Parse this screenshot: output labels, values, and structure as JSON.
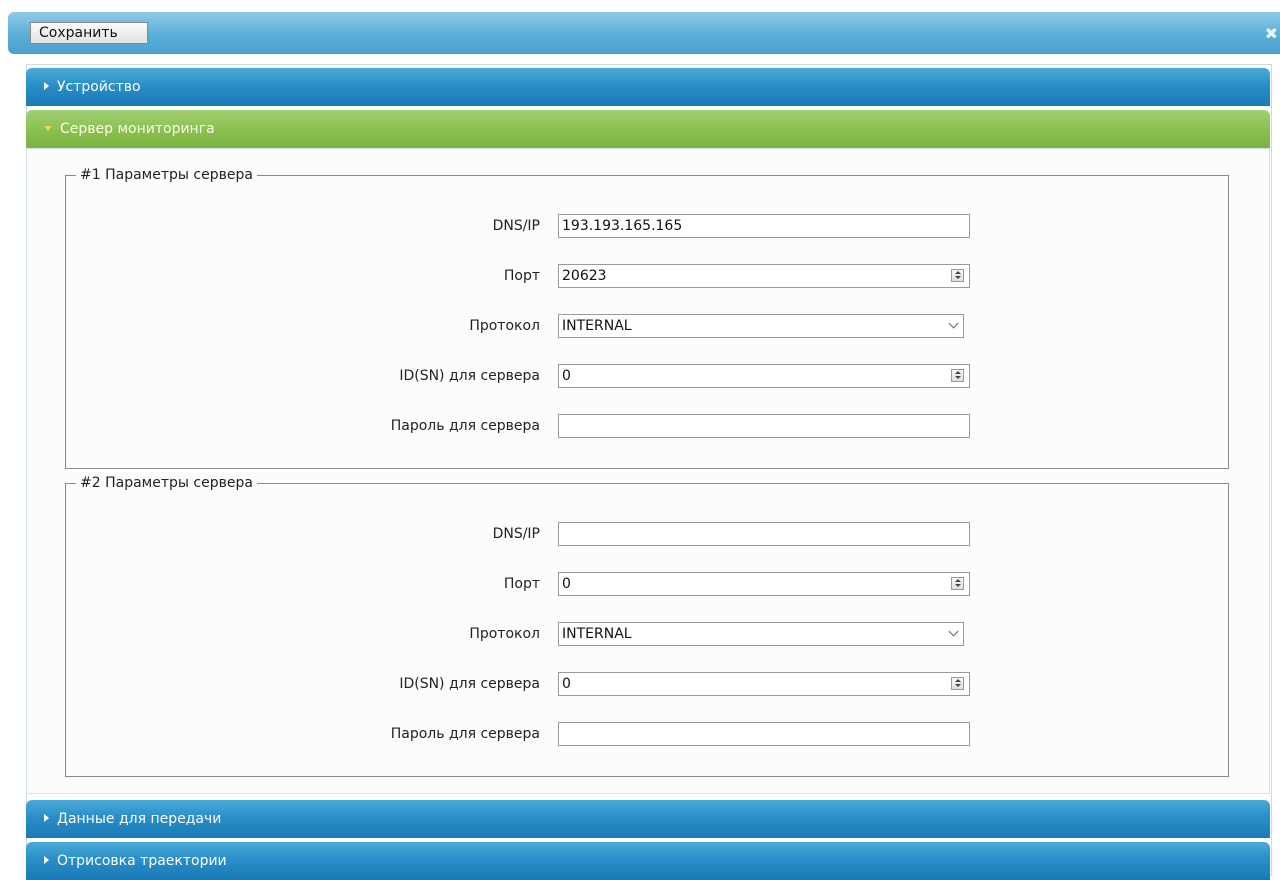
{
  "toolbar": {
    "save_label": "Сохранить",
    "close_glyph": "✖"
  },
  "accordion": [
    {
      "label": "Устройство",
      "expanded": false
    },
    {
      "label": "Сервер мониторинга",
      "expanded": true
    },
    {
      "label": "Данные для передачи",
      "expanded": false
    },
    {
      "label": "Отрисовка траектории",
      "expanded": false
    }
  ],
  "servers": [
    {
      "legend": "#1 Параметры сервера",
      "dns_label": "DNS/IP",
      "dns_value": "193.193.165.165",
      "port_label": "Порт",
      "port_value": "20623",
      "protocol_label": "Протокол",
      "protocol_value": "INTERNAL",
      "id_label": "ID(SN) для сервера",
      "id_value": "0",
      "password_label": "Пароль для сервера",
      "password_value": ""
    },
    {
      "legend": "#2 Параметры сервера",
      "dns_label": "DNS/IP",
      "dns_value": "",
      "port_label": "Порт",
      "port_value": "0",
      "protocol_label": "Протокол",
      "protocol_value": "INTERNAL",
      "id_label": "ID(SN) для сервера",
      "id_value": "0",
      "password_label": "Пароль для сервера",
      "password_value": ""
    }
  ],
  "colors": {
    "header_blue": "#2a8fc8",
    "header_green": "#8cc152",
    "topbar_blue": "#5aaed8"
  }
}
